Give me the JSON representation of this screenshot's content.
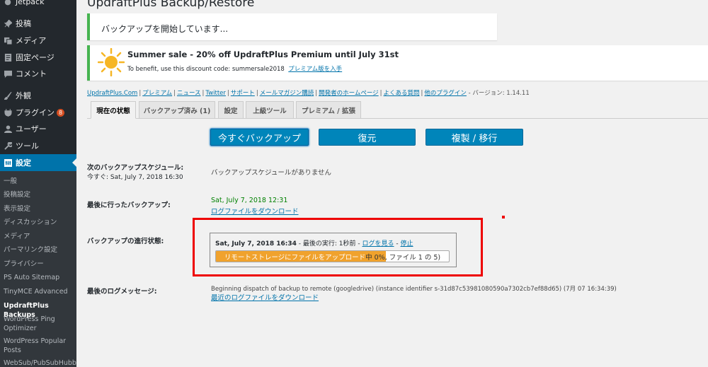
{
  "sidebar": {
    "top_cut": "Jetpack",
    "items": [
      {
        "label": "投稿",
        "icon": "pin-icon"
      },
      {
        "label": "メディア",
        "icon": "media-icon"
      },
      {
        "label": "固定ページ",
        "icon": "page-icon"
      },
      {
        "label": "コメント",
        "icon": "comment-icon"
      },
      {
        "label": "外観",
        "icon": "brush-icon"
      },
      {
        "label": "プラグイン",
        "icon": "plugin-icon",
        "badge": "8"
      },
      {
        "label": "ユーザー",
        "icon": "user-icon"
      },
      {
        "label": "ツール",
        "icon": "wrench-icon"
      },
      {
        "label": "設定",
        "icon": "settings-icon"
      }
    ],
    "submenu": [
      "一般",
      "投稿設定",
      "表示設定",
      "ディスカッション",
      "メディア",
      "パーマリンク設定",
      "プライバシー",
      "PS Auto Sitemap",
      "TinyMCE Advanced",
      "UpdraftPlus Backups",
      "WordPress Ping Optimizer",
      "WordPress Popular Posts",
      "WebSub/PubSubHubb"
    ]
  },
  "page": {
    "title": "UpdraftPlus Backup/Restore",
    "notice": "バックアップを開始しています...",
    "promo_title": "Summer sale - 20% off UpdraftPlus Premium until July 31st",
    "promo_text": "To benefit, use this discount code: summersale2018",
    "promo_link": "プレミアム版を入手",
    "links": [
      "UpdraftPlus.Com",
      "プレミアム",
      "ニュース",
      "Twitter",
      "サポート",
      "メールマガジン購読",
      "開発者のホームページ",
      "よくある質問",
      "他のプラグイン"
    ],
    "version": "- バージョン: 1.14.11",
    "tabs": [
      "現在の状態",
      "バックアップ済み (1)",
      "設定",
      "上級ツール",
      "プレミアム / 拡張"
    ],
    "buttons": {
      "backup_now": "今すぐバックアップ",
      "restore": "復元",
      "migrate": "複製 / 移行"
    },
    "next_backup_label": "次のバックアップスケジュール:",
    "now_label": "今すぐ: Sat, July 7, 2018 16:30",
    "next_backup_value": "バックアップスケジュールがありません",
    "last_backup_label": "最後に行ったバックアップ:",
    "last_backup_date": "Sat, July 7, 2018 12:31",
    "download_log": "ログファイルをダウンロード",
    "progress_label": "バックアップの進行状態:",
    "progress_date": "Sat, July 7, 2018 16:34",
    "progress_last_exec": "- 最後の実行: 1秒前 -",
    "view_log": "ログを見る",
    "stop": "停止",
    "progress_text": "リモートストレージにファイルをアップロード中 0%, ファイル 1 の 5)",
    "progress_fraction": 0.73,
    "last_log_label": "最後のログメッセージ:",
    "last_log_message": "Beginning dispatch of backup to remote (googledrive) (instance identifier s-31d87c53981080590a7302cb7ef88d65) (7月 07 16:34:39)",
    "download_latest_log": "最近のログファイルをダウンロード"
  }
}
